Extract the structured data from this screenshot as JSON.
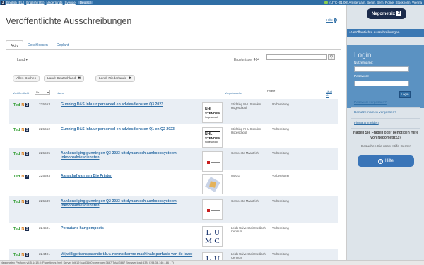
{
  "topbar": {
    "languages": [
      "English (EU)",
      "English (US)",
      "Nederlands",
      "Sverige",
      "Deutsch"
    ],
    "timezone": "(UTC+01:00) Amsterdam, Berlin, Bern, Rome, Stockholm, Vienna"
  },
  "page": {
    "title": "Veröffentlichte Ausschreibungen",
    "help_label": "Hilfe",
    "help_icon": "?"
  },
  "tabs": [
    "Aktiv",
    "Geschlossen",
    "Geplant"
  ],
  "toolbar": {
    "land_dropdown": "Land",
    "results_label": "Ergebnisse: 404",
    "search_value": "",
    "search_icon": "magnifier-icon"
  },
  "filters": {
    "clear_all": "Alles löschen",
    "chips": [
      "Land: Deutschland",
      "Land: Niederlande"
    ],
    "remove_glyph": "✖"
  },
  "columns": {
    "source": "Veröffentlicht",
    "number_select": "Nr.",
    "name": "Name",
    "buyer": "Vergabestelle",
    "phase": "Phase",
    "deadline_1": "Läuft",
    "deadline_2": "ab"
  },
  "logo_parts": {
    "ted": "Ted",
    "n": "N",
    "three": "3"
  },
  "rows": [
    {
      "number": "225653",
      "title": "Gunning D&S Inhuur personeel en adviesdiensten Q3 2023",
      "buyer": "Stichting NHL Stenden Hogeschool",
      "phase": "Vorbereitung",
      "thumb": "nhl",
      "thumb_text": [
        "NHL",
        "STENDEN",
        "hogeschool"
      ]
    },
    {
      "number": "225652",
      "title": "Gunning D&S Inhuur personeel en adviesdiensten Q1 en Q2 2023",
      "buyer": "Stichting NHL Stenden Hogeschool",
      "phase": "Vorbereitung",
      "thumb": "nhl",
      "thumb_text": [
        "NHL",
        "STENDEN",
        "hogeschool"
      ]
    },
    {
      "number": "225595",
      "title": "Aankondiging gunningen Q3 2023 uit dynamisch aankoopsysteem inkoopadviesdiensten",
      "buyer": "Gemeente Maastricht",
      "phase": "Vorbereitung",
      "thumb": "maastricht",
      "thumb_text": []
    },
    {
      "number": "225593",
      "title": "Aanschaf van een Bio Printer",
      "buyer": "UMCG",
      "phase": "Vorbereitung",
      "thumb": "umcg",
      "thumb_text": []
    },
    {
      "number": "225589",
      "title": "Aankondiging gunningen Q2 2023 uit dynamisch aankoopsysteem inkoopadviesdiensten",
      "buyer": "Gemeente Maastricht",
      "phase": "Vorbereitung",
      "thumb": "maastricht",
      "thumb_text": []
    },
    {
      "number": "224501",
      "title": "Percutane hartpompsets",
      "buyer": "Leids Universitair Medisch Centrum",
      "phase": "Vorbereitung",
      "thumb": "lumc",
      "thumb_text": [
        "L",
        "U",
        "M",
        "C"
      ]
    },
    {
      "number": "224491",
      "title": "Vrijwillige transparantie t.b.v. normotherme machinale perfusie van de lever",
      "buyer": "Leids Universitair Medisch Centrum",
      "phase": "Vorbereitung",
      "thumb": "lumc",
      "thumb_text": [
        "L",
        "U",
        "M",
        "C"
      ]
    }
  ],
  "sidebar": {
    "brand_text": "Nego",
    "brand_text_2": "metrix",
    "brand_3": "3",
    "nav_item": "Veröffentlichte Ausschreibungen",
    "login_title": "Login",
    "username_label": "Nutzername:",
    "password_label": "Passwort:",
    "login_button": "Login",
    "forgot_password": "Passwort vergessen?",
    "forgot_username": "Benutzernamen vergessen?",
    "register": "Firma anmelden",
    "question": "Haben Sie Fragen oder benötigen Hilfe von Negometrix3?",
    "support_text": "Besuchen Sie unser Hilfe-Center",
    "help_button": "Hilfe"
  },
  "footer": "Negometrix Platform v4.5.1418.0; Page times (ms) Server init:19 load:3660 prerender:3667 Total:3667 Browser load:538; (194.36.146.186 - 7)"
}
